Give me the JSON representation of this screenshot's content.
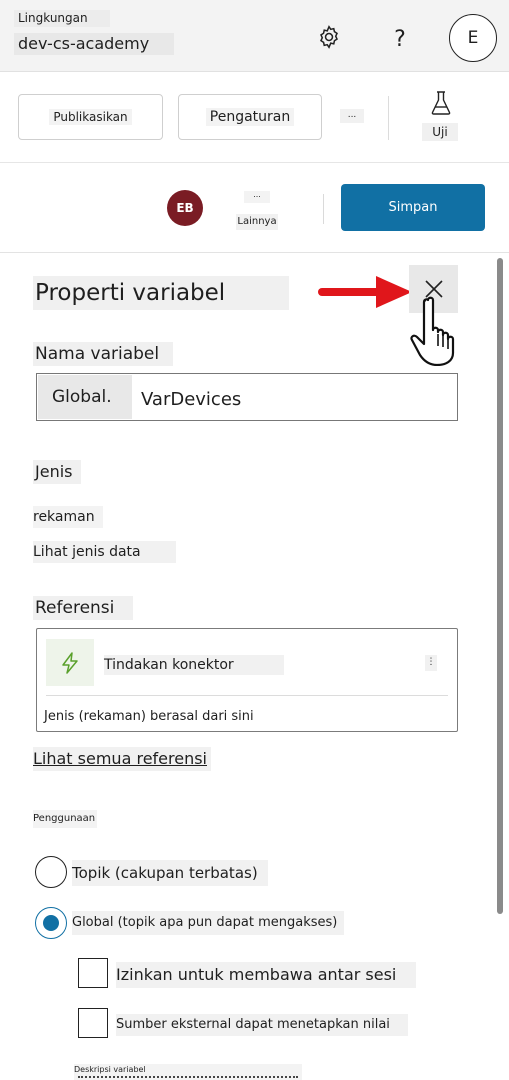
{
  "header": {
    "env_label": "Lingkungan",
    "env_name": "dev-cs-academy",
    "help_label": "?",
    "avatar_initial": "E"
  },
  "toolbar": {
    "publish_label": "Publikasikan",
    "settings_label": "Pengaturan",
    "more_label": "...",
    "test_label": "Uji"
  },
  "save_row": {
    "user_initials": "EB",
    "more_dots": "...",
    "more_label": "Lainnya",
    "save_label": "Simpan"
  },
  "panel": {
    "title": "Properti variabel",
    "variable_name_label": "Nama variabel",
    "variable_prefix": "Global.",
    "variable_value": "VarDevices",
    "type_label": "Jenis",
    "type_value": "rekaman",
    "type_link": "Lihat jenis data",
    "references_label": "Referensi",
    "reference": {
      "name": "Tindakan konektor",
      "more": "⋮",
      "source": "Jenis (rekaman) berasal dari sini"
    },
    "all_references_link": "Lihat semua referensi",
    "usage_label": "Penggunaan",
    "usage_options": [
      {
        "label": "Topik (cakupan terbatas)",
        "selected": false
      },
      {
        "label": "Global (topik apa pun dapat mengakses)",
        "selected": true
      }
    ],
    "checkboxes": [
      {
        "label": "Izinkan untuk membawa antar sesi",
        "checked": false
      },
      {
        "label": "Sumber eksternal dapat menetapkan nilai",
        "checked": false
      }
    ],
    "description_label": "Deskripsi variabel"
  },
  "colors": {
    "accent": "#1170a4",
    "avatar_bg": "#7a1c24",
    "arrow_red": "#e0161b",
    "connector_icon_green": "#5aa02c"
  },
  "icons": {
    "settings": "gear-icon",
    "test": "flask-icon",
    "close": "close-icon",
    "connector": "lightning-icon",
    "pointer": "hand-pointer-icon",
    "callout": "red-arrow-icon"
  }
}
